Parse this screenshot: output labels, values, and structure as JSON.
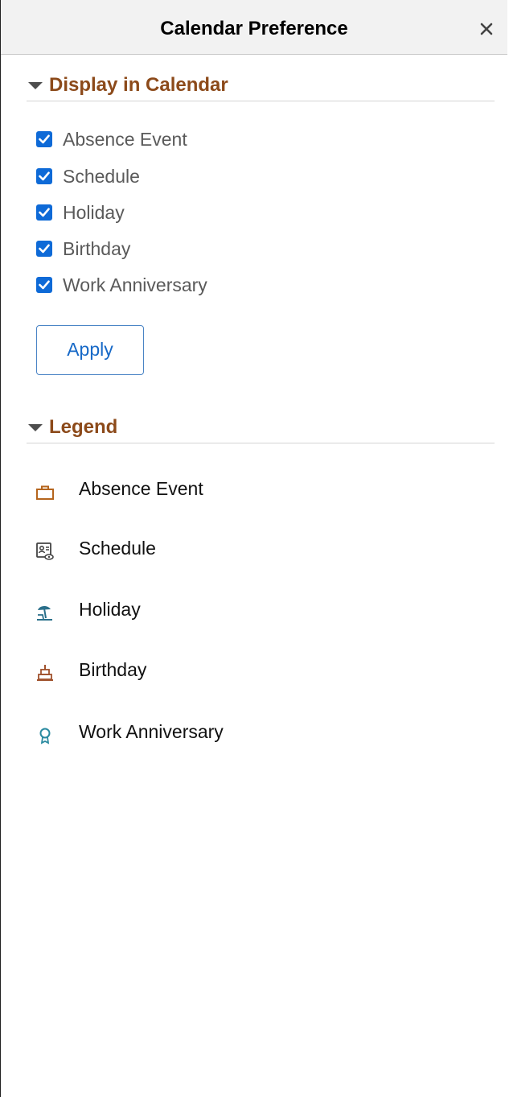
{
  "header": {
    "title": "Calendar Preference",
    "close_icon": "close-icon"
  },
  "display_section": {
    "title": "Display in Calendar",
    "options": [
      {
        "label": "Absence Event",
        "checked": true
      },
      {
        "label": "Schedule",
        "checked": true
      },
      {
        "label": "Holiday",
        "checked": true
      },
      {
        "label": "Birthday",
        "checked": true
      },
      {
        "label": "Work Anniversary",
        "checked": true
      }
    ],
    "apply_label": "Apply"
  },
  "legend_section": {
    "title": "Legend",
    "items": [
      {
        "label": "Absence Event",
        "icon": "briefcase-icon",
        "color": "#b5651d"
      },
      {
        "label": "Schedule",
        "icon": "schedule-icon",
        "color": "#444444"
      },
      {
        "label": "Holiday",
        "icon": "beach-umbrella-icon",
        "color": "#2a6f8a"
      },
      {
        "label": "Birthday",
        "icon": "birthday-cake-icon",
        "color": "#a0522d"
      },
      {
        "label": "Work Anniversary",
        "icon": "award-ribbon-icon",
        "color": "#2a8aa0"
      }
    ]
  },
  "colors": {
    "section_title": "#8c4a1a",
    "checkbox": "#0e6ad7",
    "apply_border": "#4a84c5",
    "apply_text": "#1769c7",
    "header_bg": "#f2f2f2"
  }
}
